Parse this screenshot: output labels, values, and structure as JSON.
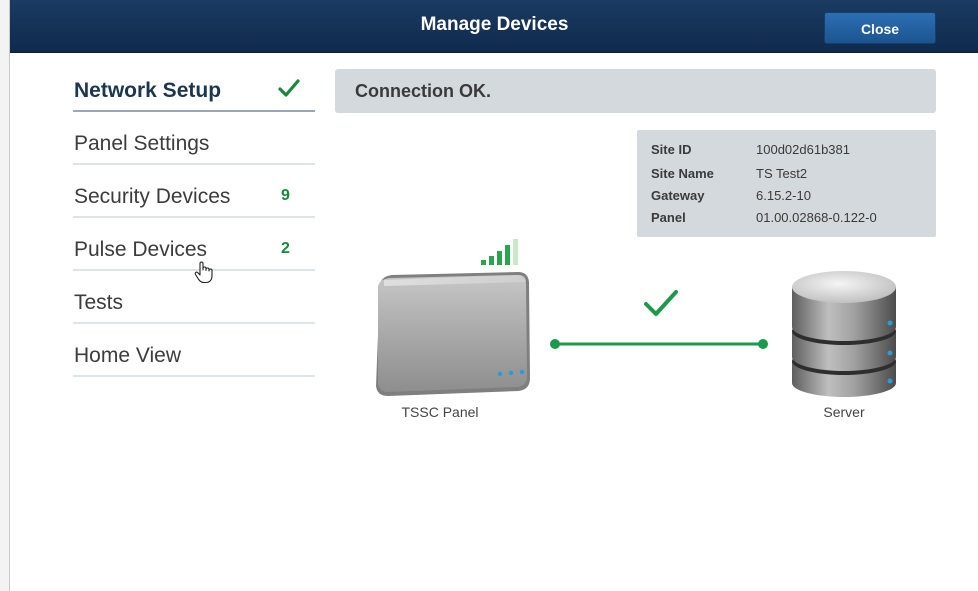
{
  "header": {
    "title": "Manage Devices",
    "close_label": "Close"
  },
  "sidebar": {
    "items": [
      {
        "label": "Network Setup",
        "badge": "",
        "status": "ok",
        "active": true
      },
      {
        "label": "Panel Settings",
        "badge": ""
      },
      {
        "label": "Security Devices",
        "badge": "9"
      },
      {
        "label": "Pulse Devices",
        "badge": "2"
      },
      {
        "label": "Tests",
        "badge": ""
      },
      {
        "label": "Home View",
        "badge": ""
      }
    ]
  },
  "status": {
    "message": "Connection OK."
  },
  "site_info": {
    "rows": [
      {
        "key": "Site ID",
        "value": "100d02d61b381"
      },
      {
        "key": "Site Name",
        "value": "TS Test2"
      },
      {
        "key": "Gateway",
        "value": "6.15.2-10"
      },
      {
        "key": "Panel",
        "value": "01.00.02868-0.122-0"
      }
    ]
  },
  "diagram": {
    "panel_label": "TSSC Panel",
    "server_label": "Server",
    "connection_status": "connected",
    "signal_bars_total": 5,
    "signal_bars_filled": 4
  },
  "colors": {
    "header_bg": "#12305a",
    "accent_green": "#178a3a",
    "connection_line": "#1a9a4a",
    "status_bg": "#d4d9de",
    "close_button": "#2563a6"
  },
  "icons": {
    "check": "check-icon",
    "signal": "signal-strength-icon",
    "panel": "panel-device-icon",
    "server": "server-database-icon",
    "cursor": "hand-pointer-icon"
  }
}
